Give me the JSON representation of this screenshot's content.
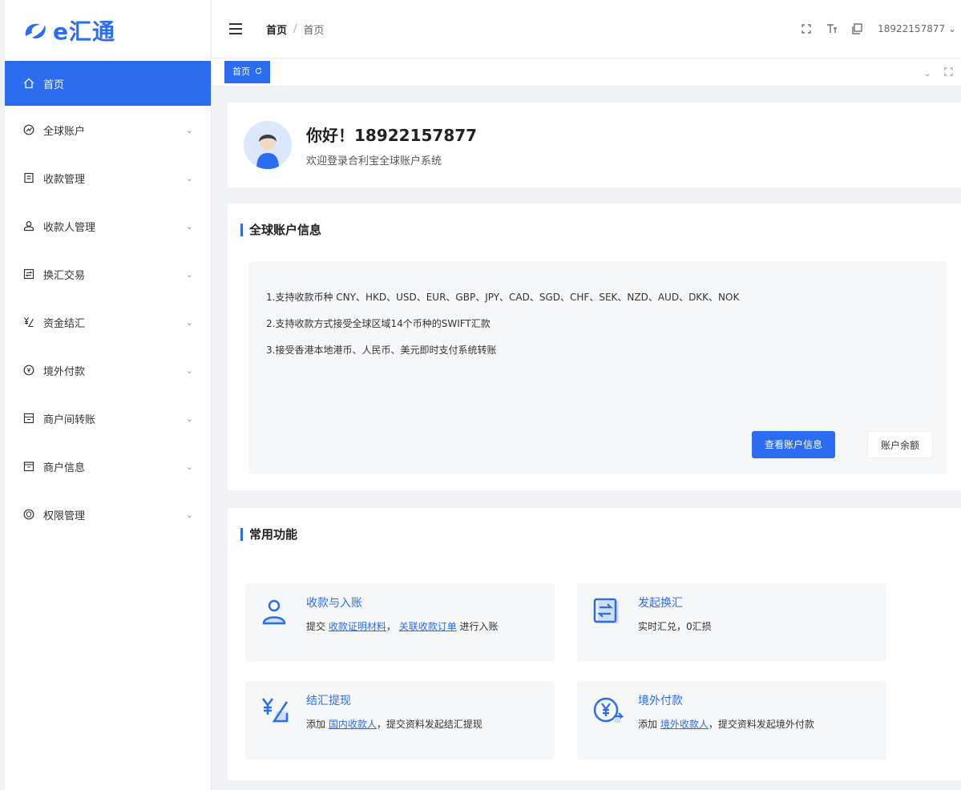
{
  "app": {
    "logo_text": "e汇通"
  },
  "sidebar": {
    "items": [
      {
        "label": "首页",
        "icon": "home-icon",
        "active": true
      },
      {
        "label": "全球账户",
        "icon": "dashboard-icon"
      },
      {
        "label": "收款管理",
        "icon": "document-icon"
      },
      {
        "label": "收款人管理",
        "icon": "user-icon"
      },
      {
        "label": "换汇交易",
        "icon": "exchange-icon"
      },
      {
        "label": "资金结汇",
        "icon": "yuan-icon"
      },
      {
        "label": "境外付款",
        "icon": "overseas-pay-icon"
      },
      {
        "label": "商户间转账",
        "icon": "transfer-icon"
      },
      {
        "label": "商户信息",
        "icon": "merchant-icon"
      },
      {
        "label": "权限管理",
        "icon": "shield-icon"
      }
    ]
  },
  "topbar": {
    "breadcrumb_root": "首页",
    "breadcrumb_sep": "/",
    "breadcrumb_current": "首页",
    "user": "18922157877"
  },
  "tabs": [
    {
      "label": "首页"
    }
  ],
  "welcome": {
    "greeting": "你好！18922157877",
    "subtitle": "欢迎登录合利宝全球账户系统"
  },
  "account_info": {
    "title": "全球账户信息",
    "lines": [
      "1.支持收款币种 CNY、HKD、USD、EUR、GBP、JPY、CAD、SGD、CHF、SEK、NZD、AUD、DKK、NOK",
      "2.支持收款方式接受全球区域14个币种的SWIFT汇款",
      "3.接受香港本地港币、人民币、美元即时支付系统转账"
    ],
    "view_button": "查看账户信息",
    "balance_button": "账户余额"
  },
  "common_functions": {
    "title": "常用功能",
    "items": [
      {
        "title": "收款与入账",
        "icon": "receive-user-icon",
        "prefix": "提交",
        "link1": "收款证明材料",
        "mid": "，",
        "link2": "关联收款订单",
        "suffix": "进行入账"
      },
      {
        "title": "发起换汇",
        "icon": "exchange-doc-icon",
        "desc": "实时汇兑，0汇损"
      },
      {
        "title": "结汇提现",
        "icon": "settle-yuan-icon",
        "prefix": "添加",
        "link1": "国内收款人",
        "suffix": "，提交资料发起结汇提现"
      },
      {
        "title": "境外付款",
        "icon": "overseas-yuan-icon",
        "prefix": "添加",
        "link1": "境外收款人",
        "suffix": "，提交资料发起境外付款"
      }
    ]
  },
  "colors": {
    "accent": "#2b6cf0"
  }
}
